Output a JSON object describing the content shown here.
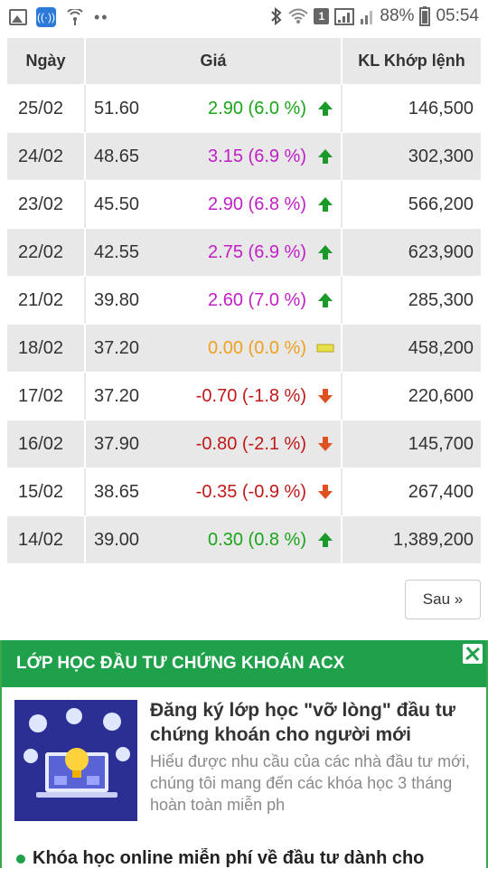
{
  "status_bar": {
    "battery_percent": "88%",
    "time": "05:54",
    "sim_badge": "1"
  },
  "table": {
    "headers": {
      "date": "Ngày",
      "price": "Giá",
      "volume": "KL Khớp lệnh"
    },
    "rows": [
      {
        "date": "25/02",
        "price": "51.60",
        "change": "2.90 (6.0 %)",
        "direction": "up",
        "color": "#1aa51a",
        "volume": "146,500"
      },
      {
        "date": "24/02",
        "price": "48.65",
        "change": "3.15 (6.9 %)",
        "direction": "up",
        "color": "#c21ec7",
        "volume": "302,300"
      },
      {
        "date": "23/02",
        "price": "45.50",
        "change": "2.90 (6.8 %)",
        "direction": "up",
        "color": "#c21ec7",
        "volume": "566,200"
      },
      {
        "date": "22/02",
        "price": "42.55",
        "change": "2.75 (6.9 %)",
        "direction": "up",
        "color": "#c21ec7",
        "volume": "623,900"
      },
      {
        "date": "21/02",
        "price": "39.80",
        "change": "2.60 (7.0 %)",
        "direction": "up",
        "color": "#c21ec7",
        "volume": "285,300"
      },
      {
        "date": "18/02",
        "price": "37.20",
        "change": "0.00 (0.0 %)",
        "direction": "flat",
        "color": "#f0a020",
        "volume": "458,200"
      },
      {
        "date": "17/02",
        "price": "37.20",
        "change": "-0.70 (-1.8 %)",
        "direction": "down",
        "color": "#c01818",
        "volume": "220,600"
      },
      {
        "date": "16/02",
        "price": "37.90",
        "change": "-0.80 (-2.1 %)",
        "direction": "down",
        "color": "#c01818",
        "volume": "145,700"
      },
      {
        "date": "15/02",
        "price": "38.65",
        "change": "-0.35 (-0.9 %)",
        "direction": "down",
        "color": "#c01818",
        "volume": "267,400"
      },
      {
        "date": "14/02",
        "price": "39.00",
        "change": "0.30 (0.8 %)",
        "direction": "up",
        "color": "#1aa51a",
        "volume": "1,389,200"
      }
    ]
  },
  "pagination": {
    "next_label": "Sau »"
  },
  "ad": {
    "heading": "LỚP HỌC ĐẦU TƯ CHỨNG KHOÁN ACX",
    "title": "Đăng ký lớp học \"vỡ lòng\" đầu tư chứng khoán cho người mới",
    "description": "Hiểu được nhu cầu của các nhà đầu tư mới, chúng tôi mang đến các khóa học 3 tháng hoàn toàn miễn ph",
    "bullet": "Khóa học online miễn phí về đầu tư dành cho",
    "accent_color": "#1fa04a"
  },
  "icons": {
    "up": "green-up-arrow-icon",
    "down": "red-down-arrow-icon",
    "flat": "yellow-flat-bar-icon"
  }
}
